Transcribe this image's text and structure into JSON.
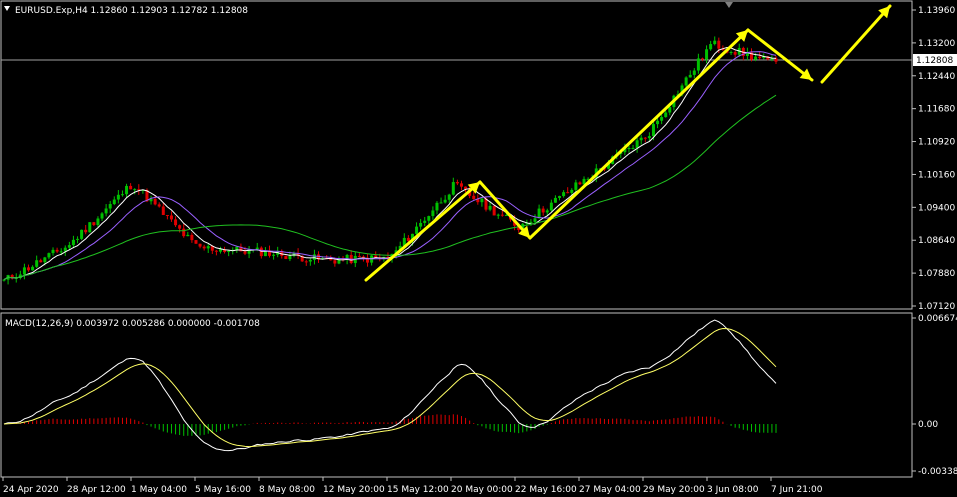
{
  "header": {
    "symbol_line": "EURUSD.Exp,H4  1.12860 1.12903 1.12782 1.12808"
  },
  "price_panel": {
    "current_price": "1.12808",
    "y_labels": [
      "1.13960",
      "1.13200",
      "1.12440",
      "1.11680",
      "1.10920",
      "1.10160",
      "1.09400",
      "1.08640",
      "1.07880",
      "1.07120"
    ]
  },
  "macd_panel": {
    "label": "MACD(12,26,9) 0.003972 0.005286 0.000000 -0.001708",
    "y_labels": [
      "0.006674",
      "0.00",
      "-0.003383"
    ]
  },
  "x_labels": [
    "24 Apr 2020",
    "28 Apr 12:00",
    "1 May 04:00",
    "5 May 16:00",
    "8 May 08:00",
    "12 May 20:00",
    "15 May 12:00",
    "20 May 00:00",
    "22 May 16:00",
    "27 May 04:00",
    "29 May 20:00",
    "3 Jun 08:00",
    "7 Jun 21:00"
  ],
  "colors": {
    "background": "#000000",
    "bull_candle": "#00c000",
    "bear_candle": "#e00000",
    "ma_fast": "#ffffff",
    "ma_mid": "#9a60ff",
    "ma_slow": "#20c020",
    "macd_line": "#ffffff",
    "signal_line": "#ffff66",
    "arrow": "#ffff00",
    "axis": "#c0c0c0"
  },
  "chart_data": {
    "type": "candlestick",
    "symbol": "EURUSD.Exp",
    "timeframe": "H4",
    "ohlc_last": {
      "open": 1.1286,
      "high": 1.12903,
      "low": 1.12782,
      "close": 1.12808
    },
    "ylim_price": [
      1.07,
      1.142
    ],
    "price_keypoints": [
      {
        "x": "24 Apr 2020",
        "y": 1.076
      },
      {
        "x": "28 Apr 12:00",
        "y": 1.0845
      },
      {
        "x": "1 May 04:00",
        "y": 1.0995
      },
      {
        "x": "5 May 16:00",
        "y": 1.084
      },
      {
        "x": "8 May 08:00",
        "y": 1.083
      },
      {
        "x": "12 May 20:00",
        "y": 1.081
      },
      {
        "x": "15 May 12:00",
        "y": 1.0815
      },
      {
        "x": "20 May 00:00",
        "y": 1.099
      },
      {
        "x": "22 May 16:00",
        "y": 1.089
      },
      {
        "x": "27 May 04:00",
        "y": 1.1
      },
      {
        "x": "29 May 20:00",
        "y": 1.111
      },
      {
        "x": "3 Jun 08:00",
        "y": 1.133
      },
      {
        "x": "7 Jun 21:00",
        "y": 1.1281
      }
    ],
    "macd": {
      "params": "MACD(12,26,9)",
      "values": [
        0.003972,
        0.005286,
        0.0,
        -0.001708
      ],
      "ylim": [
        -0.003383,
        0.006674
      ]
    },
    "annotations": [
      "yellow arrows: up-trend legs and projected pullback then rise"
    ]
  }
}
